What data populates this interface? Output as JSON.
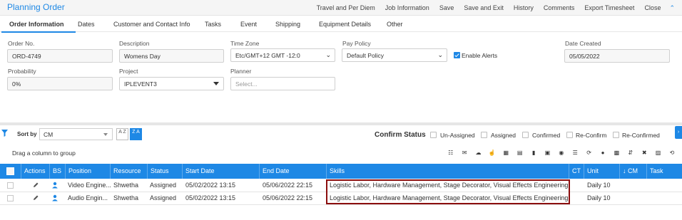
{
  "window": {
    "title": "Planning Order",
    "actions": [
      "Travel and Per Diem",
      "Job Information",
      "Save",
      "Save and Exit",
      "History",
      "Comments",
      "Export Timesheet",
      "Close"
    ],
    "collapse_icon": "chevron-up-icon"
  },
  "tabs": [
    {
      "label": "Order Information",
      "active": true
    },
    {
      "label": "Dates"
    },
    {
      "label": "Customer and Contact Info"
    },
    {
      "label": "Tasks"
    },
    {
      "label": "Event"
    },
    {
      "label": "Shipping"
    },
    {
      "label": "Equipment Details"
    },
    {
      "label": "Other"
    }
  ],
  "form": {
    "order_no": {
      "label": "Order No.",
      "value": "ORD-4749"
    },
    "description": {
      "label": "Description",
      "value": "Womens Day"
    },
    "time_zone": {
      "label": "Time Zone",
      "value": "Etc/GMT+12 GMT -12:0"
    },
    "pay_policy": {
      "label": "Pay Policy",
      "value": "Default Policy"
    },
    "enable_alerts": {
      "label": "Enable Alerts",
      "checked": true
    },
    "date_created": {
      "label": "Date Created",
      "value": "05/05/2022"
    },
    "probability": {
      "label": "Probability",
      "value": "0%"
    },
    "project": {
      "label": "Project",
      "value": "IPLEVENT3"
    },
    "planner": {
      "label": "Planner",
      "placeholder": "Select..."
    }
  },
  "toolbar": {
    "sort_by_label": "Sort by",
    "sort_by_value": "CM",
    "sort_asc_label": "A Z",
    "sort_desc_label": "Z A",
    "confirm_status_label": "Confirm Status",
    "status_filters": [
      "Un-Assigned",
      "Assigned",
      "Confirmed",
      "Re-Confirm",
      "Re-Confirmed"
    ],
    "drag_group_label": "Drag a column to group",
    "icons": [
      "assign-icon",
      "email-icon",
      "cloud-icon",
      "thumbs-up-icon",
      "grid-icon",
      "card-icon",
      "bar-chart-icon",
      "id-card-icon",
      "target-icon",
      "list-icon",
      "refresh-icon",
      "user-icon",
      "calendar-icon",
      "transfer-icon",
      "delete-icon",
      "lock-icon",
      "sync-icon"
    ]
  },
  "grid": {
    "columns": [
      "Actions",
      "BS",
      "Position",
      "Resource",
      "Status",
      "Start Date",
      "End Date",
      "Skills",
      "CT",
      "Unit",
      "↓ CM",
      "Task"
    ],
    "rows": [
      {
        "position": "Video Engine...",
        "resource": "Shwetha",
        "status": "Assigned",
        "start_date": "05/02/2022 13:15",
        "end_date": "05/06/2022 22:15",
        "skills": "Logistic Labor, Hardware Management, Stage Decorator, Visual Effects Engineering, ...",
        "ct": "",
        "unit": "Daily 10",
        "cm": "",
        "task": ""
      },
      {
        "position": "Audio Engin...",
        "resource": "Shwetha",
        "status": "Assigned",
        "start_date": "05/02/2022 13:15",
        "end_date": "05/06/2022 22:15",
        "skills": "Logistic Labor, Hardware Management, Stage Decorator, Visual Effects Engineering, ...",
        "ct": "",
        "unit": "Daily 10",
        "cm": "",
        "task": ""
      }
    ]
  },
  "colors": {
    "accent": "#1e88e5",
    "highlight_border": "#8b0e0e"
  }
}
